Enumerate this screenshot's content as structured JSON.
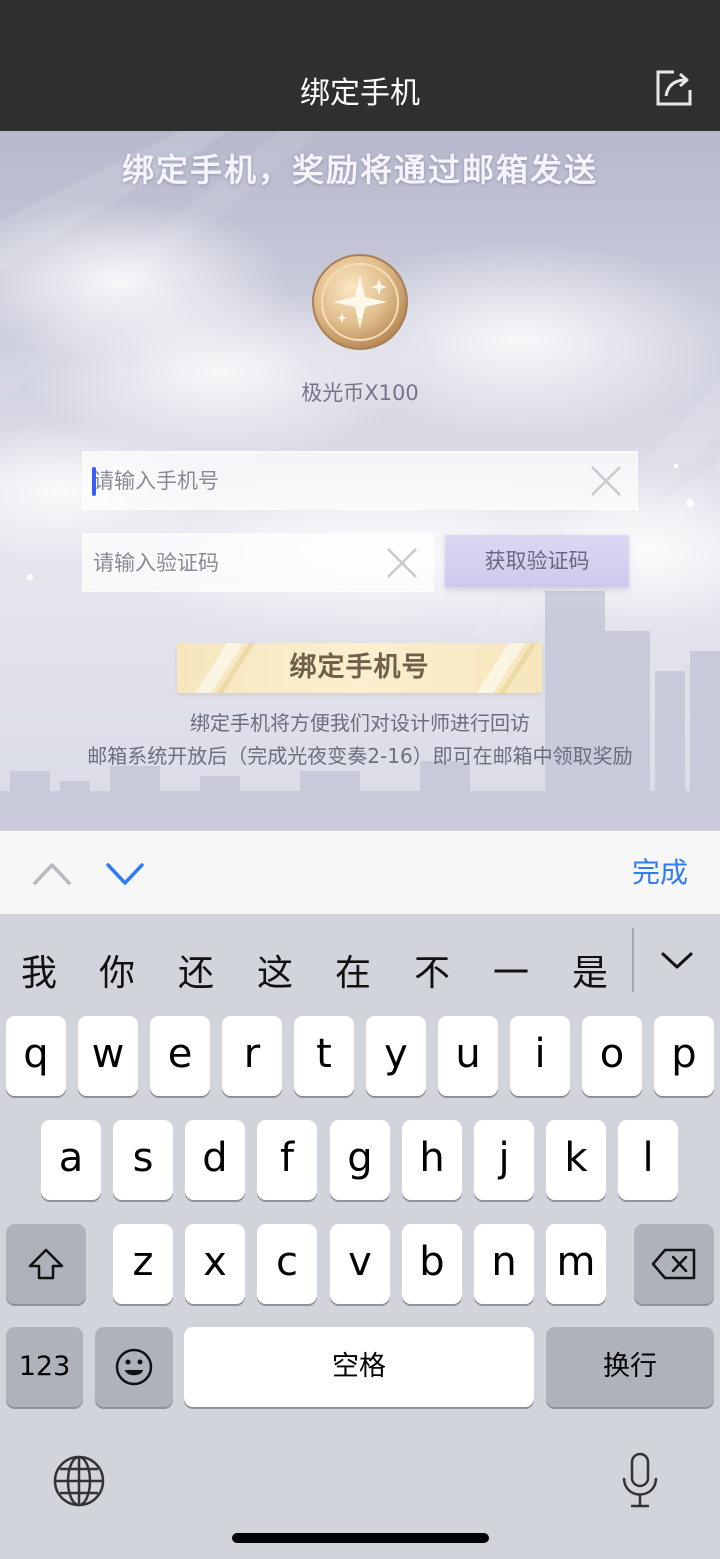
{
  "header": {
    "title": "绑定手机",
    "share_icon": "share-icon"
  },
  "content": {
    "banner": "绑定手机，奖励将通过邮箱发送",
    "reward_icon": "star-coin-icon",
    "reward_text": "极光币X100",
    "phone_placeholder": "请输入手机号",
    "code_placeholder": "请输入验证码",
    "get_code_label": "获取验证码",
    "bind_button_label": "绑定手机号",
    "note_line1": "绑定手机将方便我们对设计师进行回访",
    "note_line2": "邮箱系统开放后（完成光夜变奏2-16）即可在邮箱中领取奖励"
  },
  "accessory": {
    "done_label": "完成"
  },
  "keyboard": {
    "candidates": [
      "我",
      "你",
      "还",
      "这",
      "在",
      "不",
      "一",
      "是"
    ],
    "row1": [
      "q",
      "w",
      "e",
      "r",
      "t",
      "y",
      "u",
      "i",
      "o",
      "p"
    ],
    "row2": [
      "a",
      "s",
      "d",
      "f",
      "g",
      "h",
      "j",
      "k",
      "l"
    ],
    "row3": [
      "z",
      "x",
      "c",
      "v",
      "b",
      "n",
      "m"
    ],
    "numbers_label": "123",
    "space_label": "空格",
    "return_label": "换行"
  },
  "colors": {
    "header_bg": "#2f2f2f",
    "accent_blue": "#2f7cf6",
    "bind_button_gold": "#f6e6bd",
    "get_code_lavender": "#d6cfef"
  }
}
